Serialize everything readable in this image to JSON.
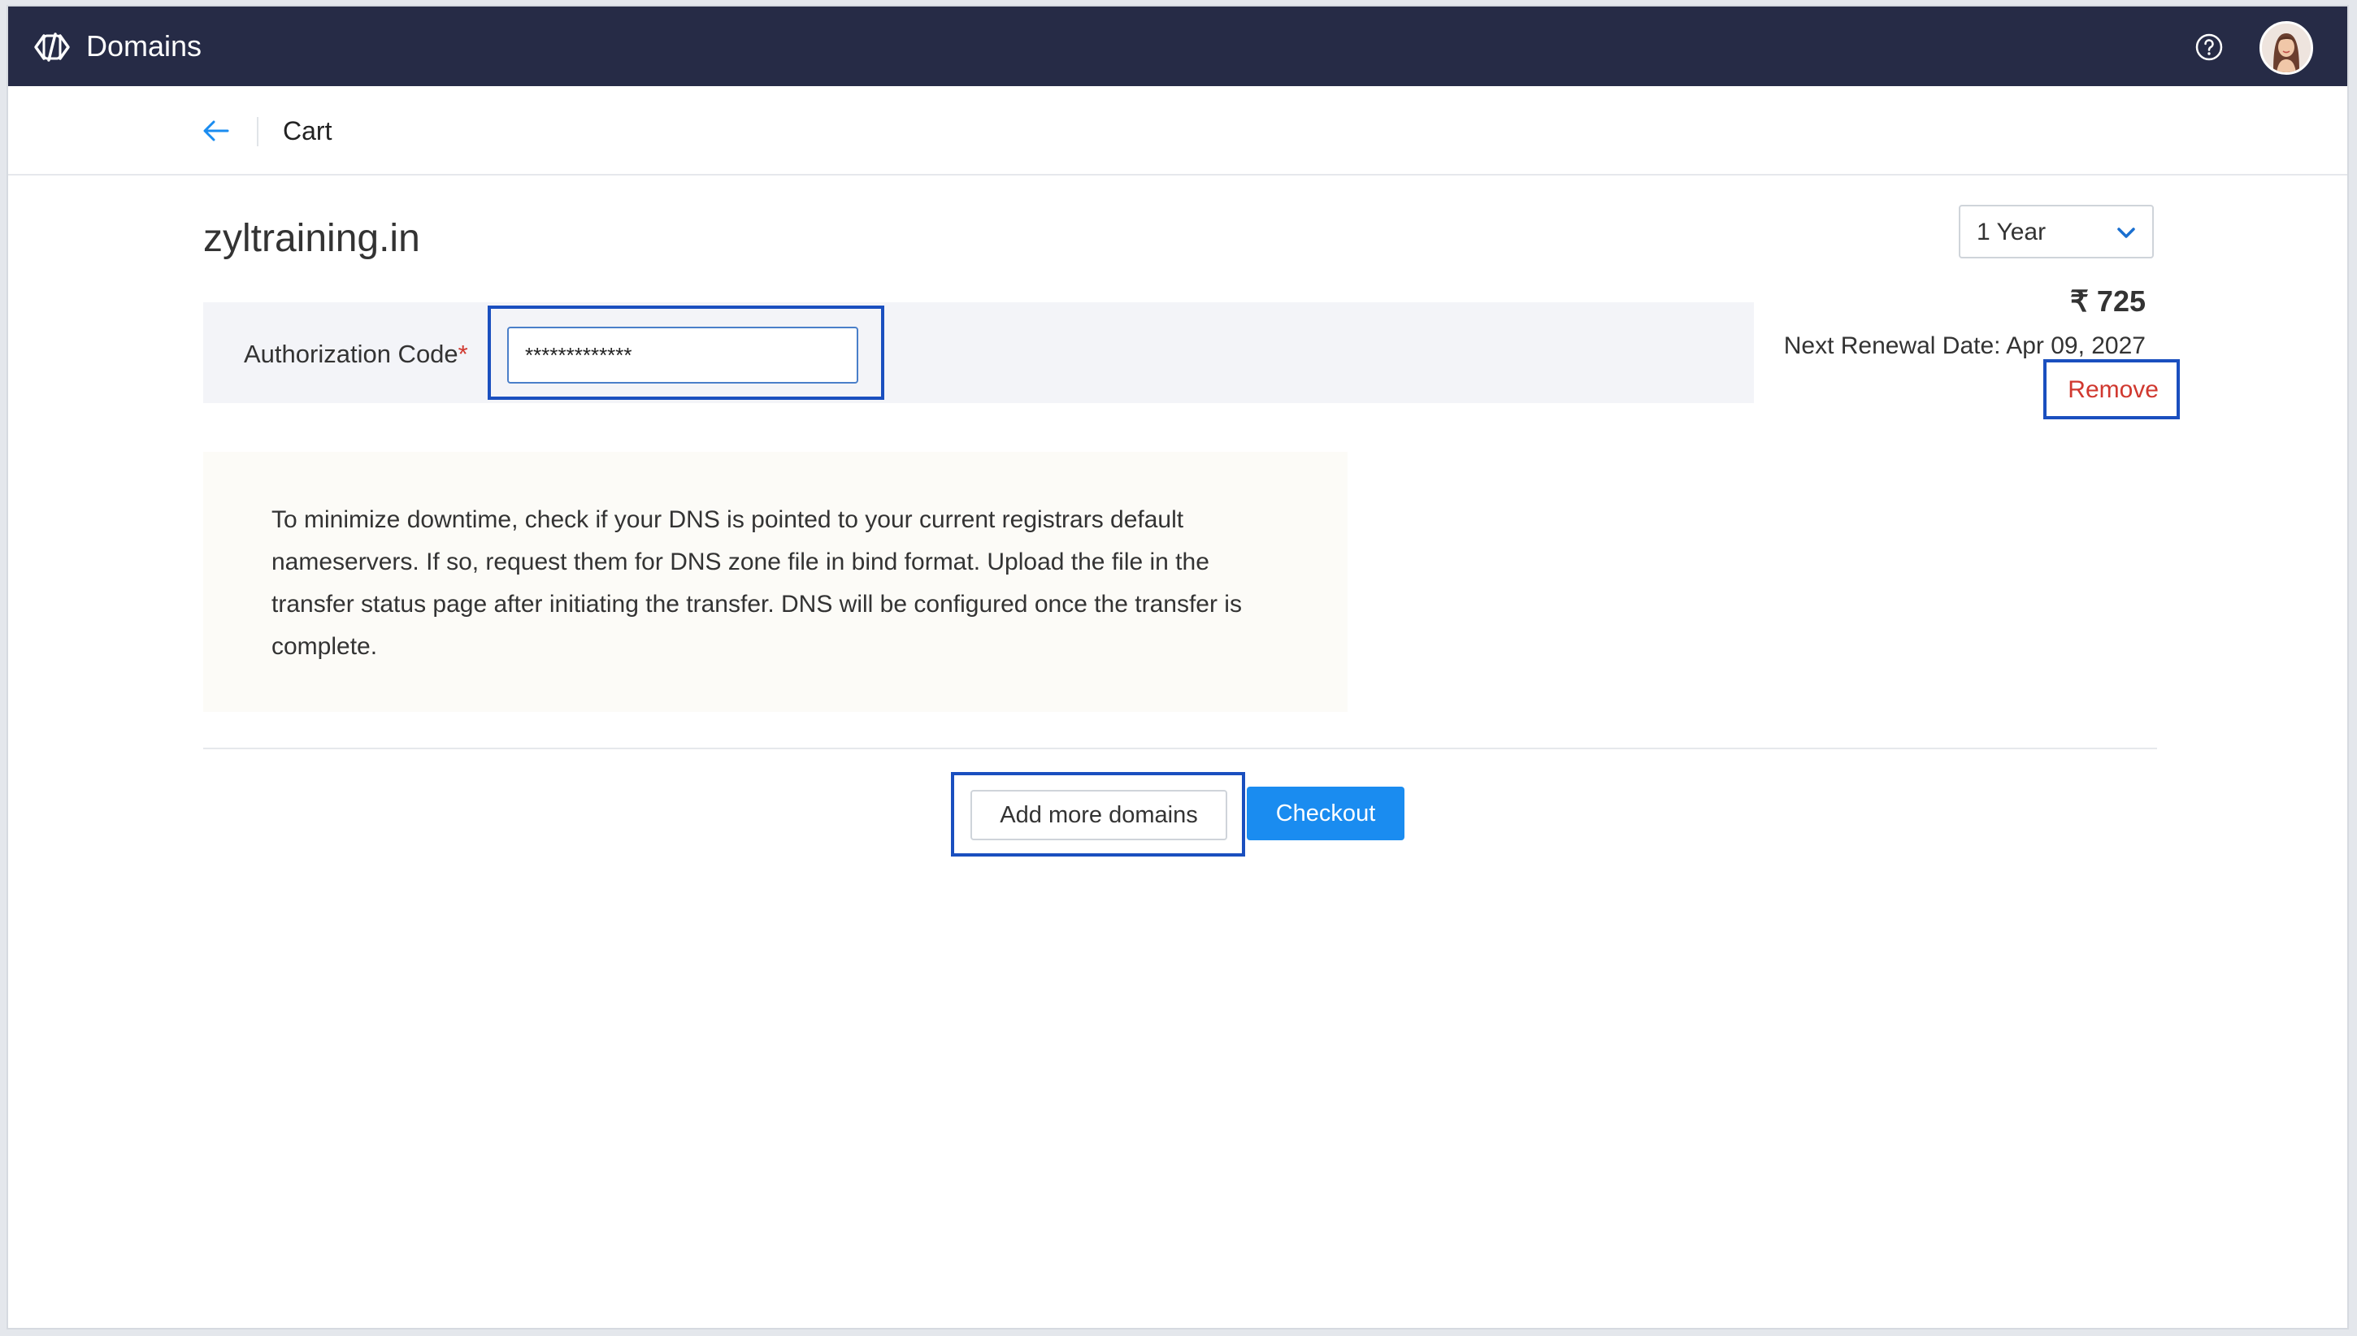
{
  "app": {
    "title": "Domains",
    "icons": {
      "logo": "domains-logo-icon",
      "help": "help-icon",
      "avatar": "user-avatar"
    }
  },
  "subheader": {
    "back_icon": "arrow-left-icon",
    "title": "Cart"
  },
  "cart_item": {
    "domain": "zyltraining.in",
    "period": {
      "selected": "1 Year",
      "icon": "chevron-down-icon"
    },
    "price": "₹ 725",
    "next_renewal": "Next Renewal Date: Apr 09, 2027",
    "remove_label": "Remove",
    "auth": {
      "label": "Authorization Code",
      "required_mark": "*",
      "value": "*************"
    },
    "info": "To minimize downtime, check if your DNS is pointed to your current registrars default nameservers. If so, request them for DNS zone file in bind format. Upload the file in the transfer status page after initiating the transfer. DNS will be configured once the transfer is complete."
  },
  "actions": {
    "add_more_label": "Add more domains",
    "checkout_label": "Checkout"
  },
  "colors": {
    "topbar": "#262b46",
    "primary": "#1a8cf0",
    "danger": "#d0382f",
    "highlight_border": "#1a4fbf"
  }
}
